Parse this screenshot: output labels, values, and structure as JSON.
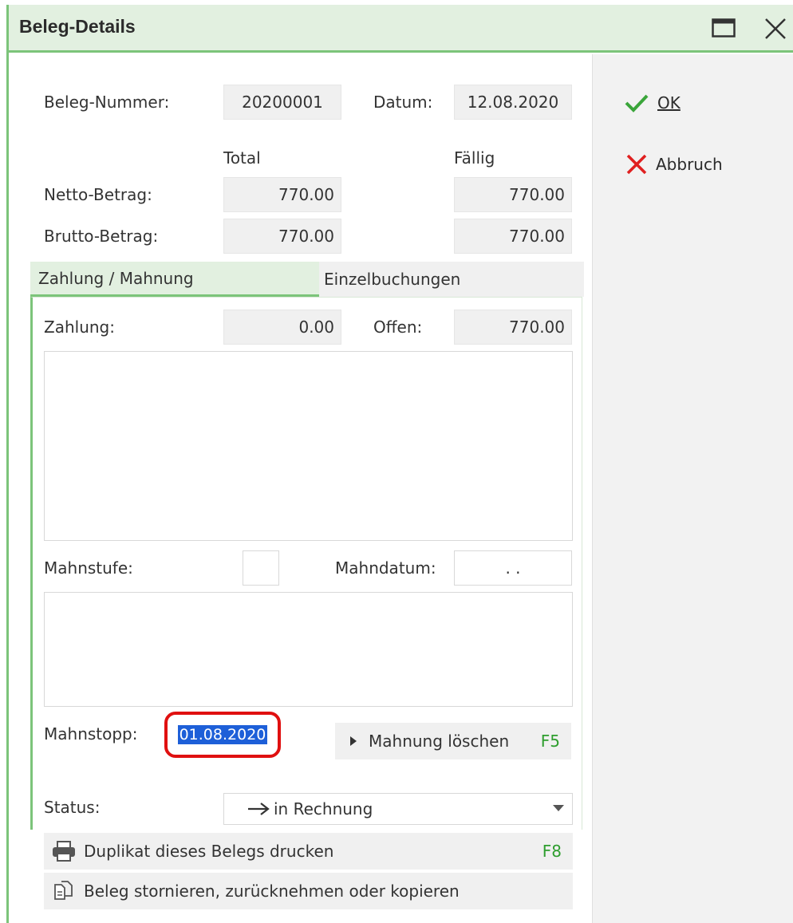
{
  "window": {
    "title": "Beleg-Details",
    "maximize_icon": "maximize-icon",
    "close_icon": "close-icon"
  },
  "header": {
    "beleg_nummer_label": "Beleg-Nummer:",
    "beleg_nummer_value": "20200001",
    "datum_label": "Datum:",
    "datum_value": "12.08.2020",
    "col_total": "Total",
    "col_faellig": "Fällig",
    "netto_label": "Netto-Betrag:",
    "netto_total": "770.00",
    "netto_faellig": "770.00",
    "brutto_label": "Brutto-Betrag:",
    "brutto_total": "770.00",
    "brutto_faellig": "770.00"
  },
  "sidebar": {
    "ok_label": "OK",
    "abbruch_label": "Abbruch"
  },
  "tabs": [
    {
      "label": "Zahlung / Mahnung",
      "active": true
    },
    {
      "label": "Einzelbuchungen",
      "active": false
    }
  ],
  "payment": {
    "zahlung_label": "Zahlung:",
    "zahlung_value": "0.00",
    "offen_label": "Offen:",
    "offen_value": "770.00",
    "mahnstufe_label": "Mahnstufe:",
    "mahnstufe_value": "",
    "mahndatum_label": "Mahndatum:",
    "mahndatum_value": ". .",
    "mahnstopp_label": "Mahnstopp:",
    "mahnstopp_value": "01.08.2020",
    "mahnung_loeschen_label": "Mahnung löschen",
    "mahnung_loeschen_key": "F5",
    "status_label": "Status:",
    "status_value": "in Rechnung"
  },
  "actions": {
    "duplikat_label": "Duplikat dieses Belegs drucken",
    "duplikat_key": "F8",
    "stornieren_label": "Beleg stornieren, zurücknehmen oder kopieren"
  },
  "colors": {
    "accent_green": "#7cc47a",
    "title_bg": "#e2f0e0",
    "highlight_red": "#e01010",
    "selection_blue": "#1d5fd8",
    "fkey_green": "#2e9e2e"
  }
}
